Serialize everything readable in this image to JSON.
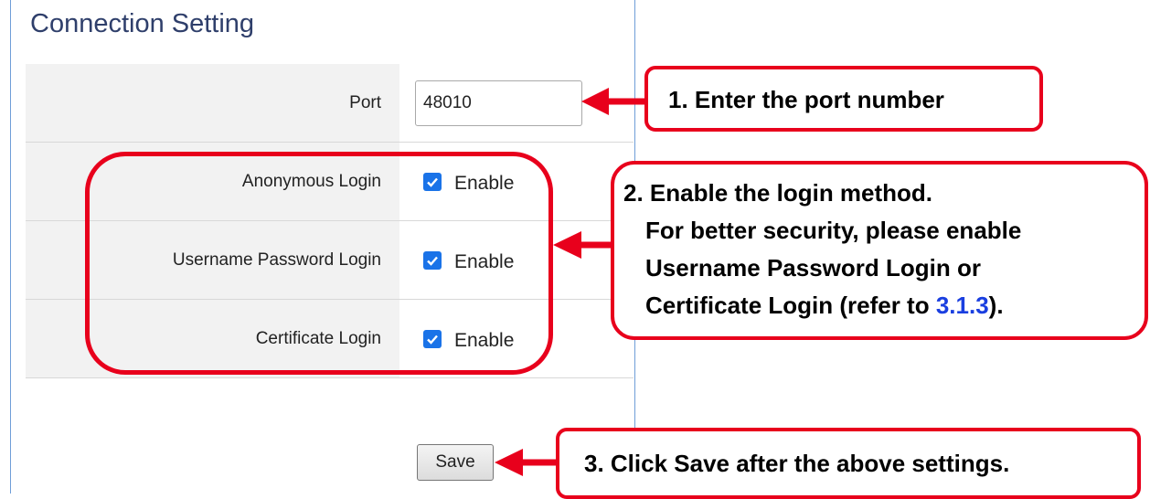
{
  "panel": {
    "title": "Connection Setting",
    "rows": [
      {
        "label": "Port",
        "value": "48010"
      },
      {
        "label": "Anonymous Login",
        "checked": true,
        "option": "Enable"
      },
      {
        "label": "Username Password Login",
        "checked": true,
        "option": "Enable"
      },
      {
        "label": "Certificate Login",
        "checked": true,
        "option": "Enable"
      }
    ],
    "save_label": "Save"
  },
  "callouts": {
    "step1": "1. Enter the port number",
    "step2": {
      "line1": "2. Enable the login method.",
      "line2": "For better security, please enable",
      "line3": "Username Password Login or",
      "line4_prefix": "Certificate Login (refer to ",
      "line4_link": "3.1.3",
      "line4_suffix": ")."
    },
    "step3": "3. Click Save after the above settings."
  },
  "colors": {
    "callout_border": "#e8001c",
    "panel_border": "#6f9ed8",
    "checkbox": "#1a73e8",
    "link": "#1a3fe0"
  }
}
